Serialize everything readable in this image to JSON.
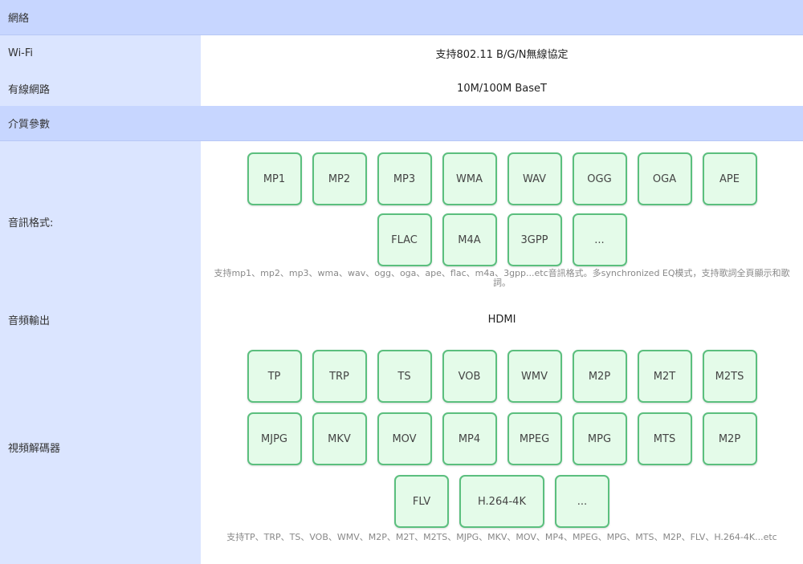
{
  "sections": {
    "network": "網絡",
    "media": "介質參數"
  },
  "rows": {
    "wifi": {
      "label": "Wi-Fi",
      "value": "支持802.11 B/G/N無線協定"
    },
    "wired": {
      "label": "有線網路",
      "value": "10M/100M BaseT"
    },
    "audio_format": {
      "label": "音訊格式:"
    },
    "audio_output": {
      "label": "音頻輸出",
      "value": "HDMI"
    },
    "video_decoder": {
      "label": "視頻解碼器"
    }
  },
  "audio_formats": [
    "MP1",
    "MP2",
    "MP3",
    "WMA",
    "WAV",
    "OGG",
    "OGA",
    "APE",
    "FLAC",
    "M4A",
    "3GPP",
    "..."
  ],
  "audio_note": "支持mp1、mp2、mp3、wma、wav、ogg、oga、ape、flac、m4a、3gpp...etc音訊格式。多synchronized EQ模式，支持歌詞全頁顯示和歌詞。",
  "video_formats": [
    "TP",
    "TRP",
    "TS",
    "VOB",
    "WMV",
    "M2P",
    "M2T",
    "M2TS",
    "MJPG",
    "MKV",
    "MOV",
    "MP4",
    "MPEG",
    "MPG",
    "MTS",
    "M2P",
    "FLV",
    "H.264-4K",
    "..."
  ],
  "video_note": "支持TP、TRP、TS、VOB、WMV、M2P、M2T、M2TS、MJPG、MKV、MOV、MP4、MPEG、MPG、MTS、M2P、FLV、H.264-4K...etc",
  "colors": {
    "section_bg": "#c7d6ff",
    "label_bg": "#dbe5ff",
    "tile_bg": "#e4fbe9",
    "tile_border": "#5bbf7e"
  }
}
